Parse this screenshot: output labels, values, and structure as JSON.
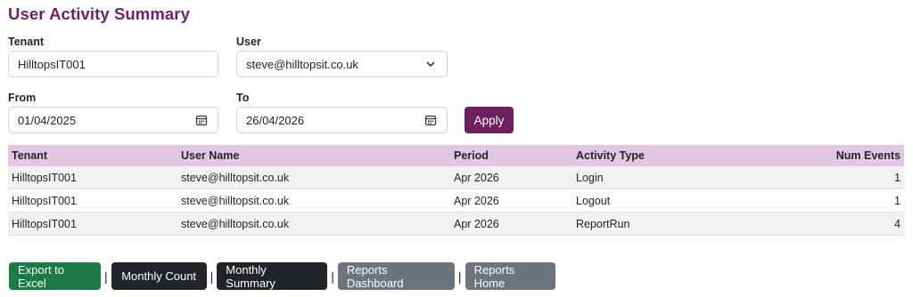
{
  "page": {
    "title": "User Activity Summary"
  },
  "filters": {
    "tenant_label": "Tenant",
    "tenant_value": "HilltopsIT001",
    "user_label": "User",
    "user_value": "steve@hilltopsit.co.uk",
    "from_label": "From",
    "from_value": "01/04/2025",
    "to_label": "To",
    "to_value": "26/04/2026",
    "apply_label": "Apply"
  },
  "table": {
    "headers": [
      "Tenant",
      "User Name",
      "Period",
      "Activity Type",
      "Num Events"
    ],
    "rows": [
      [
        "HilltopsIT001",
        "steve@hilltopsit.co.uk",
        "Apr 2026",
        "Login",
        "1"
      ],
      [
        "HilltopsIT001",
        "steve@hilltopsit.co.uk",
        "Apr 2026",
        "Logout",
        "1"
      ],
      [
        "HilltopsIT001",
        "steve@hilltopsit.co.uk",
        "Apr 2026",
        "ReportRun",
        "4"
      ]
    ]
  },
  "footer": {
    "export_label": "Export to Excel",
    "monthly_count_label": "Monthly Count",
    "monthly_summary_label": "Monthly Summary",
    "reports_dashboard_label": "Reports Dashboard",
    "reports_home_label": "Reports Home",
    "separator": "|"
  },
  "icons": {
    "user_dropdown": "chevron-down-icon",
    "from_calendar": "calendar-icon",
    "to_calendar": "calendar-icon"
  },
  "colors": {
    "title": "#6d2466",
    "apply": "#6d1f5e",
    "header_row": "#e1c7e2",
    "export": "#1c7a45",
    "dark_button": "#212529",
    "gray_button": "#6c757d"
  }
}
